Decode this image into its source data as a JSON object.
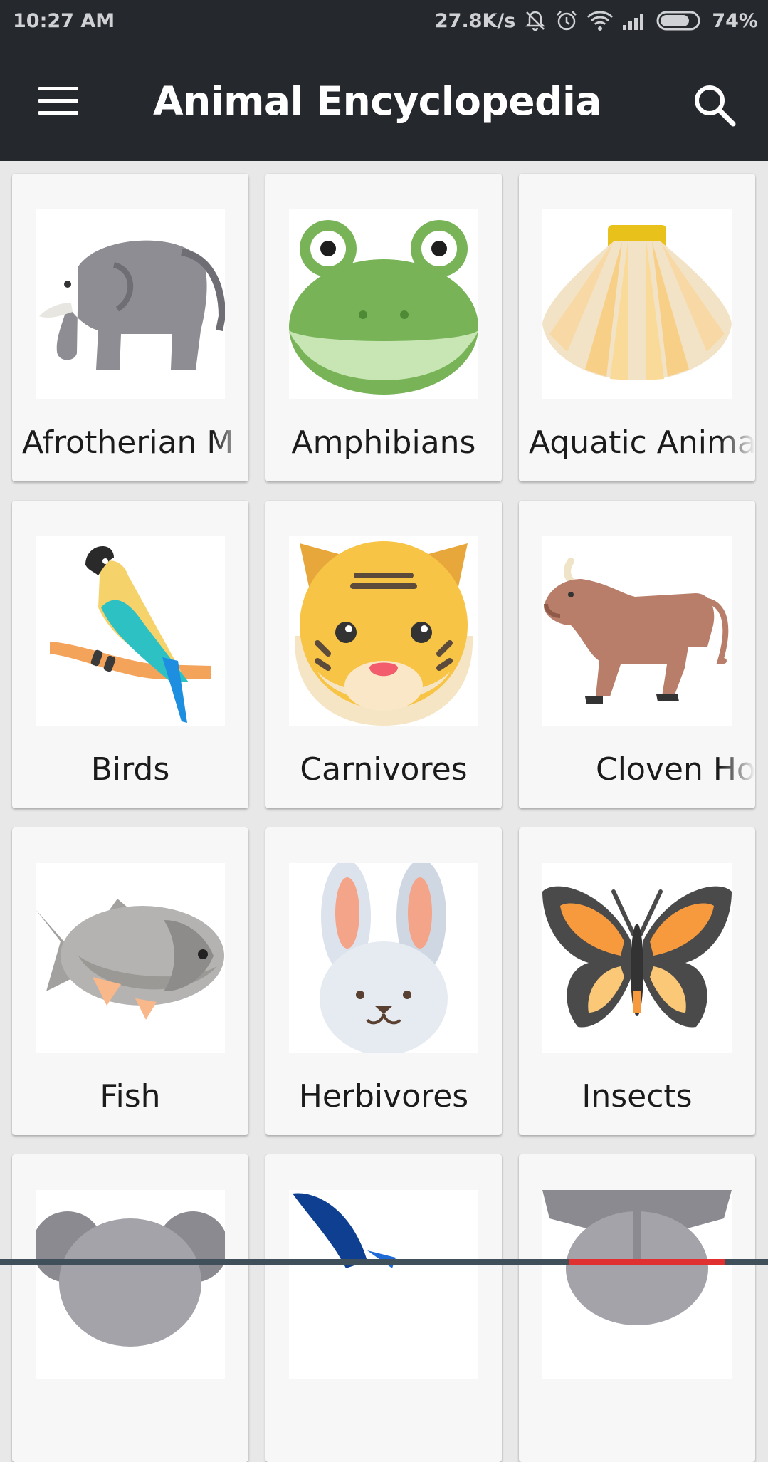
{
  "status_bar": {
    "time": "10:27 AM",
    "net_speed": "27.8K/s",
    "battery": "74%",
    "icons": [
      "mute-icon",
      "alarm-icon",
      "wifi-icon",
      "signal-icon",
      "battery-icon"
    ]
  },
  "app_bar": {
    "title": "Animal Encyclopedia",
    "menu_icon": "hamburger-menu-icon",
    "search_icon": "search-icon",
    "background": "#25282c"
  },
  "categories": [
    {
      "label": "Afrotherian M",
      "icon": "elephant-icon"
    },
    {
      "label": "Amphibians",
      "icon": "frog-icon"
    },
    {
      "label": "Aquatic Anima",
      "icon": "shell-icon"
    },
    {
      "label": "Birds",
      "icon": "parrot-icon"
    },
    {
      "label": "Carnivores",
      "icon": "tiger-icon"
    },
    {
      "label": "Cloven Ho",
      "icon": "bull-icon"
    },
    {
      "label": "Fish",
      "icon": "fish-icon"
    },
    {
      "label": "Herbivores",
      "icon": "rabbit-icon"
    },
    {
      "label": "Insects",
      "icon": "butterfly-icon"
    },
    {
      "label": "",
      "icon": "koala-icon"
    },
    {
      "label": "",
      "icon": "bat-icon"
    },
    {
      "label": "",
      "icon": "rhino-icon"
    }
  ]
}
